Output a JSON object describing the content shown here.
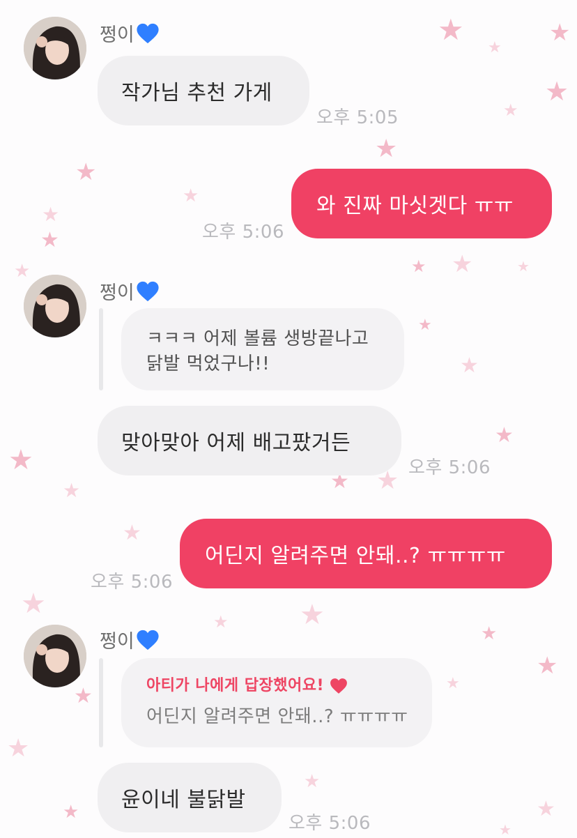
{
  "chat": {
    "sender_name": "쩡이",
    "colors": {
      "outgoing_bubble": "#f04164",
      "incoming_bubble": "#f0eff1",
      "reply_label": "#ee4563",
      "name_heart": "#2f7fff"
    },
    "messages": [
      {
        "direction": "in",
        "show_header": true,
        "text": "작가님 추천 가게",
        "time": "오후 5:05"
      },
      {
        "direction": "out",
        "text": "와 진짜 마싯겟다 ㅠㅠ",
        "time": "오후 5:06"
      },
      {
        "direction": "in",
        "show_header": true,
        "type": "quote",
        "quote_lines": [
          "ㅋㅋㅋ 어제 볼륨 생방끝나고",
          "닭발 먹었구나!!"
        ]
      },
      {
        "direction": "in",
        "text": "맞아맞아 어제 배고팠거든",
        "time": "오후 5:06"
      },
      {
        "direction": "out",
        "text": "어딘지 알려주면 안돼..? ㅠㅠㅠㅠ",
        "time": "오후 5:06"
      },
      {
        "direction": "in",
        "show_header": true,
        "type": "reply",
        "reply_label": "아티가 나에게 답장했어요!",
        "reply_text": "어딘지 알려주면 안돼..? ㅠㅠㅠㅠ"
      },
      {
        "direction": "in",
        "text": "윤이네 불닭발",
        "time": "오후 5:06"
      }
    ]
  },
  "icons": {
    "name_badge": "blue-heart-icon",
    "reply_badge": "red-heart-icon",
    "avatar": "profile-photo",
    "background": "pink-star-pattern"
  }
}
